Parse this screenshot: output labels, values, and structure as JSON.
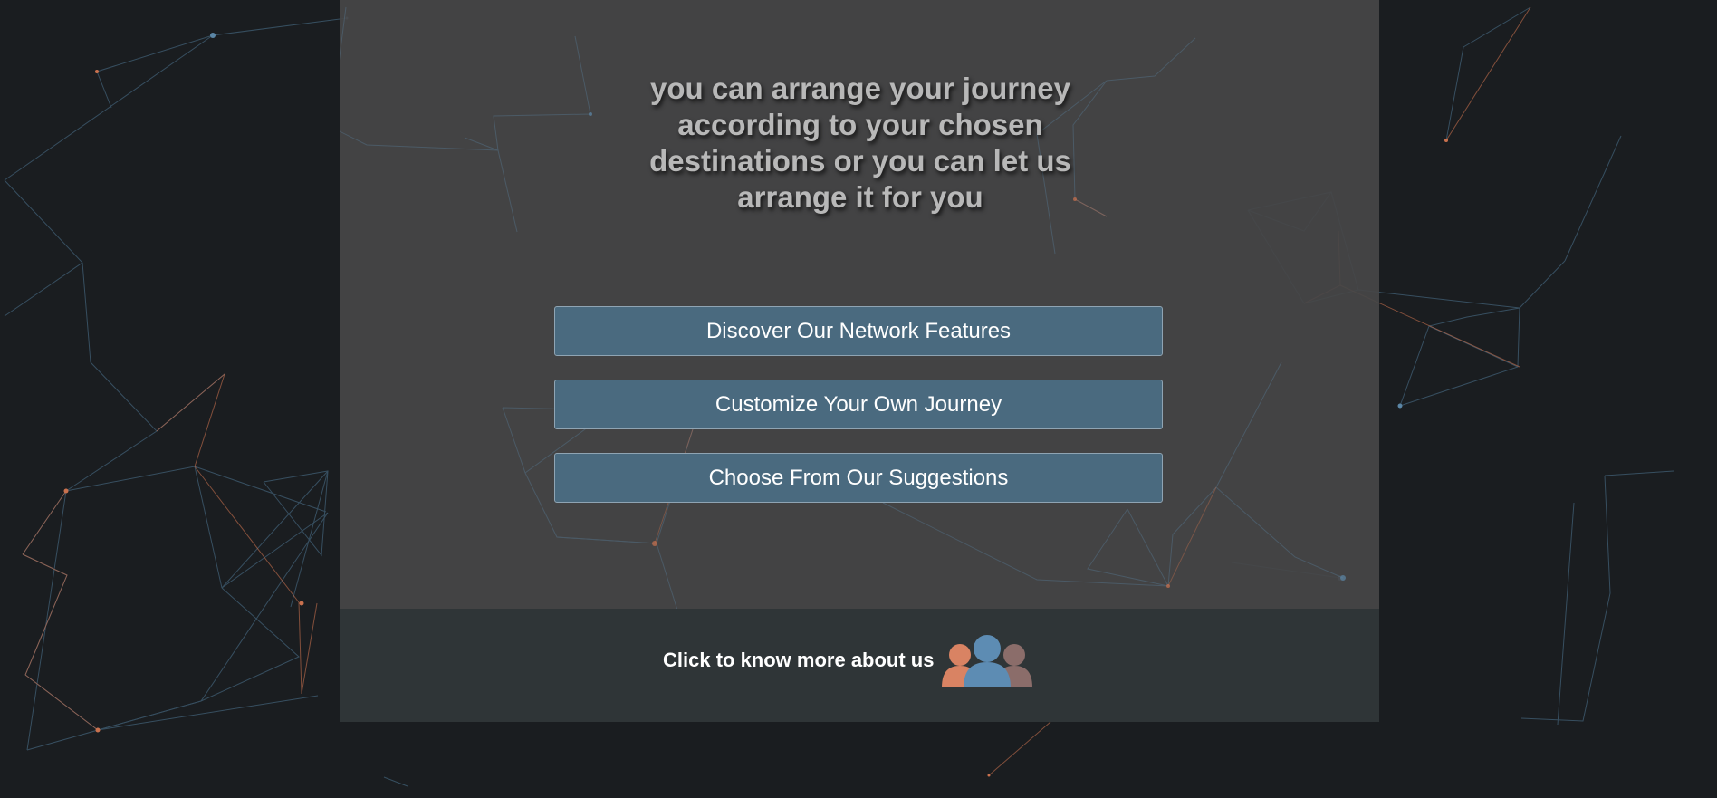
{
  "hero": {
    "headline": "you can arrange your journey according to your chosen destinations or you can let us arrange it for you"
  },
  "actions": [
    {
      "label": "Discover Our Network Features"
    },
    {
      "label": "Customize Your Own Journey"
    },
    {
      "label": "Choose From Our Suggestions"
    }
  ],
  "footer": {
    "about_label": "Click to know more about us",
    "icon": "team-icon"
  },
  "colors": {
    "page_background": "#1a1d20",
    "panel_background": "#464648",
    "button_background": "#4a6a7f",
    "footer_background": "#2f3537",
    "network_blue": "#5b86a6",
    "network_orange": "#c9714e"
  }
}
